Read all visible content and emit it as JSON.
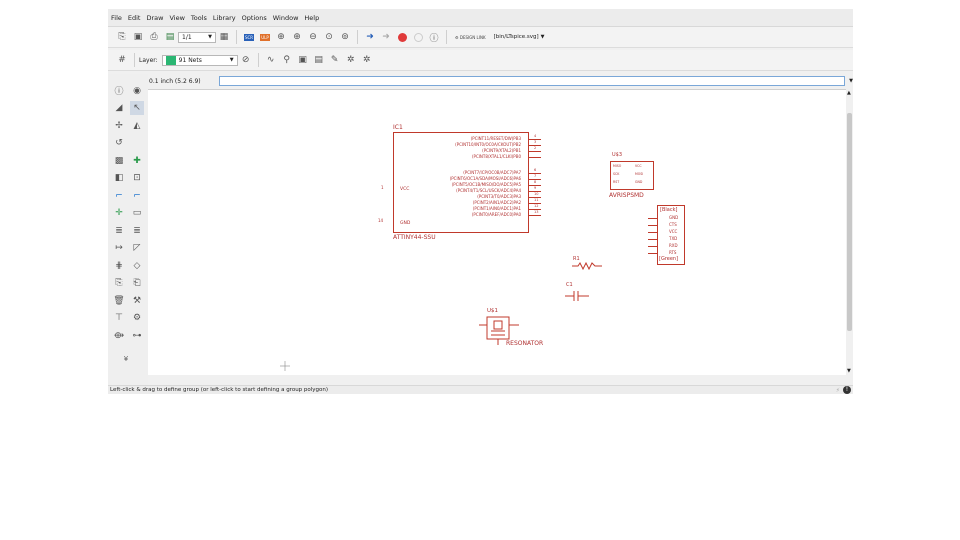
{
  "menu": [
    "File",
    "Edit",
    "Draw",
    "View",
    "Tools",
    "Library",
    "Options",
    "Window",
    "Help"
  ],
  "toolbar": {
    "sheet_value": "1/1",
    "file_label": "[bin/LTspice.svg]",
    "design_link_label": "DESIGN LINK"
  },
  "layer": {
    "label": "Layer:",
    "value": "91 Nets",
    "color": "#2bb673"
  },
  "coord_readout": "0.1 inch (5.2 6.9)",
  "command_value": "",
  "status": {
    "text": "Left-click & drag to define group (or left-click to start defining a group polygon)"
  },
  "schematic": {
    "ic1": {
      "name": "IC1",
      "value": "ATTINY44-SSU",
      "left_pins": [
        {
          "num": "1",
          "label": "VCC"
        },
        {
          "num": "14",
          "label": "GND"
        }
      ],
      "right_pins": [
        {
          "num": "4",
          "label": "(PCINT11/RESET/DW)PB3"
        },
        {
          "num": "3",
          "label": "(PCINT10/INT0/OC0A/CKOUT)PB2"
        },
        {
          "num": "2",
          "label": "(PCINT9/XTAL2)PB1"
        },
        {
          "num": "",
          "label": "(PCINT8/XTAL1/CLKI)PB0"
        },
        {
          "num": "6",
          "label": "(PCINT7/ICP/OC0B/ADC7)PA7"
        },
        {
          "num": "7",
          "label": "(PCINT6/OC1A/SDA/MOSI/ADC6)PA6"
        },
        {
          "num": "8",
          "label": "(PCINT5/OC1B/MISO/DO/ADC5)PA5"
        },
        {
          "num": "9",
          "label": "(PCINT4/T1/SCL/USCK/ADC4)PA4"
        },
        {
          "num": "10",
          "label": "(PCINT3/T0/ADC3)PA3"
        },
        {
          "num": "11",
          "label": "(PCINT2/AIN1/ADC2)PA2"
        },
        {
          "num": "12",
          "label": "(PCINT1/AIN0/ADC1)PA1"
        },
        {
          "num": "13",
          "label": "(PCINT0/AREF/ADC0)PA0"
        }
      ]
    },
    "isp": {
      "name": "U$3",
      "value": "AVRISPSMD",
      "pins_left": [
        "MISO",
        "SCK",
        "RST"
      ],
      "pins_right": [
        "VCC",
        "MOSI",
        "GND"
      ]
    },
    "ftdi": {
      "top": "[Black]",
      "bottom": "[Green]",
      "pins": [
        "GND",
        "CTS",
        "VCC",
        "TXD",
        "RXD",
        "RTS"
      ]
    },
    "r1": "R1",
    "c1": "C1",
    "resonator": {
      "name": "U$1",
      "value": "RESONATOR"
    }
  }
}
